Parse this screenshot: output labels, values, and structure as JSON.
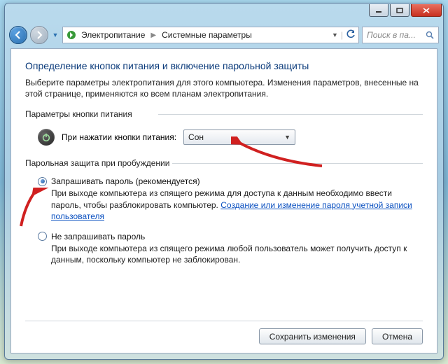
{
  "titlebar": {
    "min_tip": "Свернуть",
    "max_tip": "Развернуть",
    "close_tip": "Закрыть"
  },
  "nav": {
    "back_tip": "Назад",
    "fwd_tip": "Вперёд",
    "crumb1": "Электропитание",
    "crumb2": "Системные параметры",
    "refresh_tip": "Обновить",
    "search_placeholder": "Поиск в па..."
  },
  "page": {
    "title": "Определение кнопок питания и включение парольной защиты",
    "intro": "Выберите параметры электропитания для этого компьютера. Изменения параметров, внесенные на этой странице, применяются ко всем планам электропитания.",
    "group_power": "Параметры кнопки питания",
    "power_label": "При нажатии кнопки питания:",
    "power_value": "Сон",
    "group_password": "Парольная защита при пробуждении",
    "opt_require": {
      "label": "Запрашивать пароль (рекомендуется)",
      "desc_before": "При выходе компьютера из спящего режима для доступа к данным необходимо ввести пароль, чтобы разблокировать компьютер. ",
      "link": "Создание или изменение пароля учетной записи пользователя"
    },
    "opt_norequire": {
      "label": "Не запрашивать пароль",
      "desc": "При выходе компьютера из спящего режима любой пользователь может получить доступ к данным, поскольку компьютер не заблокирован."
    },
    "save": "Сохранить изменения",
    "cancel": "Отмена"
  }
}
